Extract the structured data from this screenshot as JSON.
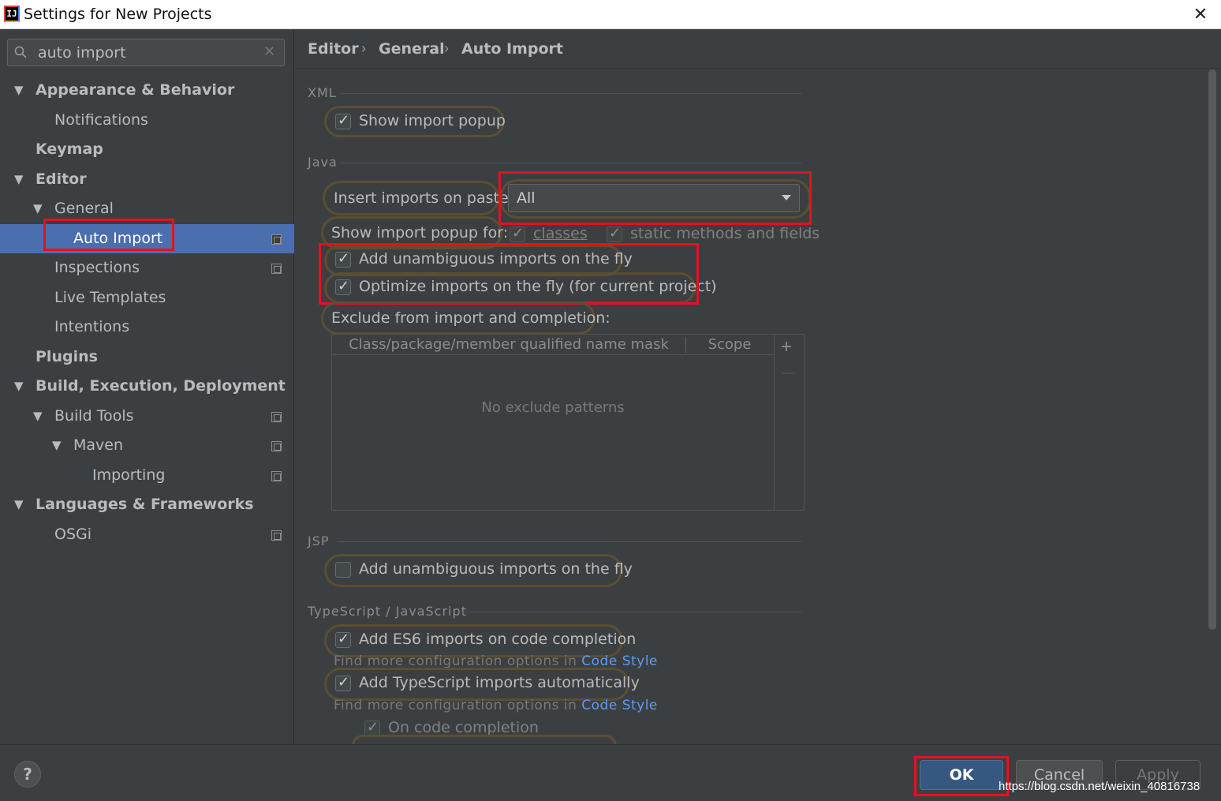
{
  "window": {
    "title": "Settings for New Projects",
    "app_icon_text": "IJ"
  },
  "search": {
    "value": "auto import"
  },
  "sidebar": {
    "items": [
      {
        "label": "Appearance & Behavior"
      },
      {
        "label": "Notifications"
      },
      {
        "label": "Keymap"
      },
      {
        "label": "Editor"
      },
      {
        "label": "General"
      },
      {
        "label": "Auto Import"
      },
      {
        "label": "Inspections"
      },
      {
        "label": "Live Templates"
      },
      {
        "label": "Intentions"
      },
      {
        "label": "Plugins"
      },
      {
        "label": "Build, Execution, Deployment"
      },
      {
        "label": "Build Tools"
      },
      {
        "label": "Maven"
      },
      {
        "label": "Importing"
      },
      {
        "label": "Languages & Frameworks"
      },
      {
        "label": "OSGi"
      }
    ]
  },
  "breadcrumb": {
    "items": [
      "Editor",
      "General",
      "Auto Import"
    ]
  },
  "xml": {
    "title": "XML",
    "show_import_popup": {
      "label": "Show import popup",
      "checked": true
    }
  },
  "java": {
    "title": "Java",
    "insert_imports_label": "Insert imports on paste:",
    "insert_imports_value": "All",
    "show_popup_for_label": "Show import popup for:",
    "classes_label": "classes",
    "static_label": "static methods and fields",
    "add_unambiguous": {
      "label": "Add unambiguous imports on the fly",
      "checked": true
    },
    "optimize_imports": {
      "label": "Optimize imports on the fly (for current project)",
      "checked": true
    },
    "exclude_label": "Exclude from import and completion:",
    "table": {
      "columns": [
        "Class/package/member qualified name mask",
        "Scope"
      ],
      "empty_text": "No exclude patterns",
      "add_symbol": "+",
      "remove_symbol": "—"
    }
  },
  "jsp": {
    "title": "JSP",
    "add_unambiguous": {
      "label": "Add unambiguous imports on the fly",
      "checked": false
    }
  },
  "typescript": {
    "title": "TypeScript / JavaScript",
    "add_es6": {
      "label": "Add ES6 imports on code completion",
      "checked": true
    },
    "hint_prefix": "Find more configuration options in ",
    "hint_link": "Code Style",
    "add_ts": {
      "label": "Add TypeScript imports automatically",
      "checked": true
    },
    "on_code_completion": {
      "label": "On code completion",
      "checked": true
    }
  },
  "footer": {
    "help": "?",
    "ok": "OK",
    "cancel": "Cancel",
    "apply": "Apply",
    "watermark": "https://blog.csdn.net/weixin_40816738"
  },
  "colors": {
    "background": "#3c3f41",
    "selection": "#4b6eaf",
    "annotation_red": "#e8101b",
    "link": "#589df6",
    "ok_button": "#365880"
  }
}
